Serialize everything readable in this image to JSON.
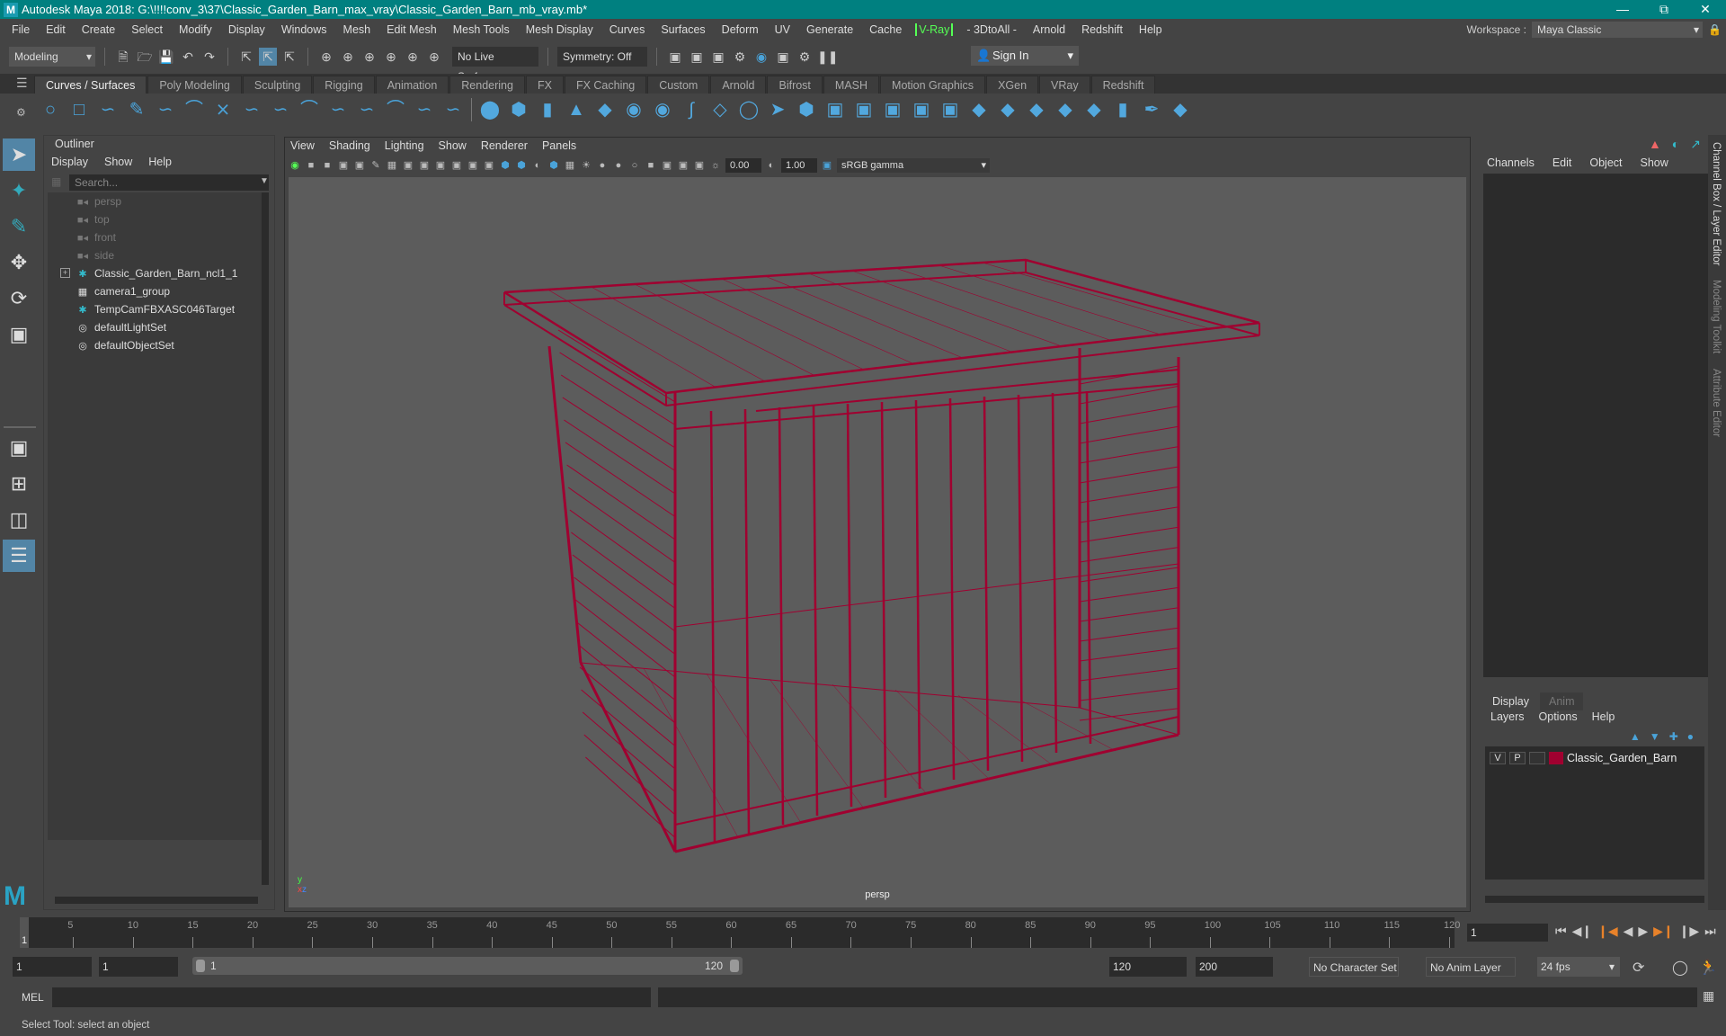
{
  "window": {
    "title": "Autodesk Maya 2018: G:\\!!!!conv_3\\37\\Classic_Garden_Barn_max_vray\\Classic_Garden_Barn_mb_vray.mb*",
    "controls": [
      "minimize",
      "maximize",
      "close"
    ]
  },
  "menubar": {
    "items": [
      "File",
      "Edit",
      "Create",
      "Select",
      "Modify",
      "Display",
      "Windows",
      "Mesh",
      "Edit Mesh",
      "Mesh Tools",
      "Mesh Display",
      "Curves",
      "Surfaces",
      "Deform",
      "UV",
      "Generate",
      "Cache"
    ],
    "vray": "V-Ray",
    "items2": [
      "- 3DtoAll -",
      "Arnold",
      "Redshift",
      "Help"
    ]
  },
  "workspace": {
    "label": "Workspace :",
    "value": "Maya Classic"
  },
  "toolbar": {
    "mode": "Modeling",
    "live_surface": "No Live Surface",
    "symmetry": "Symmetry: Off",
    "sign_in": "Sign In"
  },
  "shelf": {
    "tabs": [
      "Curves / Surfaces",
      "Poly Modeling",
      "Sculpting",
      "Rigging",
      "Animation",
      "Rendering",
      "FX",
      "FX Caching",
      "Custom",
      "Arnold",
      "Bifrost",
      "MASH",
      "Motion Graphics",
      "XGen",
      "VRay",
      "Redshift"
    ],
    "active_tab": "Curves / Surfaces"
  },
  "outliner": {
    "title": "Outliner",
    "menus": [
      "Display",
      "Show",
      "Help"
    ],
    "search_placeholder": "Search...",
    "items": [
      {
        "label": "persp",
        "icon": "camera-icon",
        "dim": true
      },
      {
        "label": "top",
        "icon": "camera-icon",
        "dim": true
      },
      {
        "label": "front",
        "icon": "camera-icon",
        "dim": true
      },
      {
        "label": "side",
        "icon": "camera-icon",
        "dim": true
      },
      {
        "label": "Classic_Garden_Barn_ncl1_1",
        "icon": "transform-icon",
        "expandable": true
      },
      {
        "label": "camera1_group",
        "icon": "group-icon"
      },
      {
        "label": "TempCamFBXASC046Target",
        "icon": "transform-icon"
      },
      {
        "label": "defaultLightSet",
        "icon": "set-icon"
      },
      {
        "label": "defaultObjectSet",
        "icon": "set-icon"
      }
    ]
  },
  "viewport": {
    "menus": [
      "View",
      "Shading",
      "Lighting",
      "Show",
      "Renderer",
      "Panels"
    ],
    "exposure": "0.00",
    "gamma": "1.00",
    "color_space": "sRGB gamma",
    "camera": "persp",
    "wire_color": "#a00030"
  },
  "channel_box": {
    "menus": [
      "Channels",
      "Edit",
      "Object",
      "Show"
    ]
  },
  "layer_editor": {
    "tabs": [
      "Display",
      "Anim"
    ],
    "active_tab": "Display",
    "menus": [
      "Layers",
      "Options",
      "Help"
    ],
    "layers": [
      {
        "v": "V",
        "p": "P",
        "name": "Classic_Garden_Barn",
        "color": "#a00030"
      }
    ]
  },
  "side_tabs": [
    "Channel Box / Layer Editor",
    "Modeling Toolkit",
    "Attribute Editor"
  ],
  "timeline": {
    "ticks": [
      5,
      10,
      15,
      20,
      25,
      30,
      35,
      40,
      45,
      50,
      55,
      60,
      65,
      70,
      75,
      80,
      85,
      90,
      95,
      100,
      105,
      110,
      115,
      120
    ],
    "start": 1,
    "end": 120,
    "current_frame": "1"
  },
  "range": {
    "start_field": "1",
    "start2_field": "1",
    "slider_start": "1",
    "slider_end": "120",
    "end_field": "120",
    "end2_field": "200",
    "character_set": "No Character Set",
    "anim_layer": "No Anim Layer",
    "fps": "24 fps"
  },
  "command_line": {
    "label": "MEL"
  },
  "status": {
    "text": "Select Tool: select an object"
  }
}
